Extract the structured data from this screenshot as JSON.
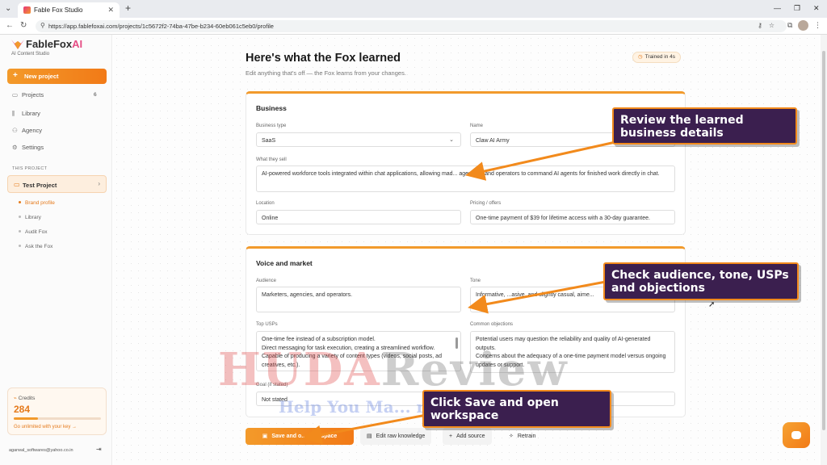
{
  "browser": {
    "tab_title": "Fable Fox Studio",
    "url": "https://app.fablefoxai.com/projects/1c5672f2-74ba-47be-b234-60eb061c5eb0/profile"
  },
  "sidebar": {
    "logo": "FableFox",
    "logo_ai": "AI",
    "tagline": "AI Content Studio",
    "new_project": "New project",
    "nav": [
      {
        "label": "Projects",
        "icon": "folder-icon",
        "count": "6"
      },
      {
        "label": "Library",
        "icon": "library-icon"
      },
      {
        "label": "Agency",
        "icon": "agency-icon"
      },
      {
        "label": "Settings",
        "icon": "gear-icon"
      }
    ],
    "section_label": "THIS PROJECT",
    "project_name": "Test Project",
    "project_sub": [
      "Brand profile",
      "Library",
      "Audit Fox",
      "Ask the Fox"
    ],
    "credits_label": "Credits",
    "credits_value": "284",
    "credits_fraction": 0.28,
    "credits_link": "Go unlimited with your key →",
    "user_email": "agarwal_softwares@yahoo.co.in"
  },
  "header": {
    "title": "Here's what the Fox learned",
    "subtitle": "Edit anything that's off — the Fox learns from your changes.",
    "trained_badge": "Trained in 4s"
  },
  "business": {
    "title": "Business",
    "business_type_label": "Business type",
    "business_type_value": "SaaS",
    "name_label": "Name",
    "name_value": "Claw AI Army",
    "what_they_sell_label": "What they sell",
    "what_they_sell_value": "AI-powered workforce tools integrated within chat applications, allowing mad... agencies, and operators to command AI agents for finished work directly in chat.",
    "location_label": "Location",
    "location_value": "Online",
    "pricing_label": "Pricing / offers",
    "pricing_value": "One-time payment of $39 for lifetime access with a 30-day guarantee."
  },
  "voice": {
    "title": "Voice and market",
    "audience_label": "Audience",
    "audience_value": "Marketers, agencies, and operators.",
    "tone_label": "Tone",
    "tone_value": "Informative, ...asive, and slightly casual, aime...",
    "usps_label": "Top USPs",
    "usps_value": "One-time fee instead of a subscription model.\nDirect messaging for task execution, creating a streamlined workflow.\nCapable of producing a variety of content types (videos, social posts, ad creatives, etc.).",
    "objections_label": "Common objections",
    "objections_value": "Potential users may question the reliability and quality of AI-generated outputs.\nConcerns about the adequacy of a one-time payment model versus ongoing updates or support.",
    "goal_label": "Goal (if stated)",
    "goal_value": "Not stated"
  },
  "actions": {
    "save": "Save and o... workspace",
    "edit_raw": "Edit raw knowledge",
    "add_source": "Add source",
    "retrain": "Retrain"
  },
  "watermark": {
    "line1_a": "HUDA",
    "line1_b": "Review",
    "line2": "Help You Ma... r Decisions"
  },
  "callouts": {
    "c1": "Review the learned business details",
    "c2": "Check audience, tone, USPs and objections",
    "c3": "Click Save and open workspace"
  },
  "colors": {
    "accent": "#f28a1c",
    "callout_bg": "#3b1f4f"
  }
}
